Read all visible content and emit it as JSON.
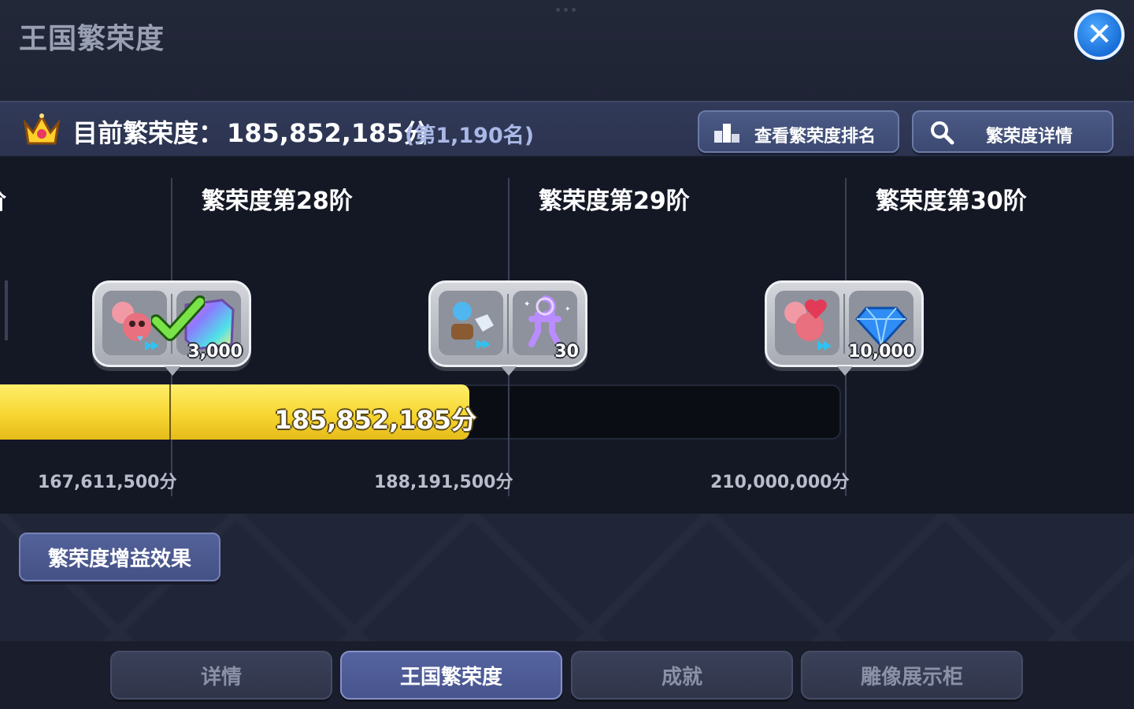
{
  "window": {
    "title": "王国繁荣度",
    "close_icon": "close-icon"
  },
  "status": {
    "label": "目前繁荣度：",
    "value": "185,852,185分",
    "rank": "(第1,190名)",
    "ranking_button": "查看繁荣度排名",
    "details_button": "繁荣度详情"
  },
  "progress": {
    "current": 185852185,
    "current_label": "185,852,185分",
    "track_max": 210000000,
    "partial_tier_title": "阶",
    "tiers": [
      {
        "title": "繁荣度第28阶",
        "threshold": 167611500,
        "threshold_label": "167,611,500分",
        "reward_quantity": "3,000",
        "claimed": true,
        "reward_icons": [
          "cookie-bundle-icon",
          "rainbow-cube-icon"
        ]
      },
      {
        "title": "繁荣度第29阶",
        "threshold": 188191500,
        "threshold_label": "188,191,500分",
        "reward_quantity": "30",
        "claimed": false,
        "reward_icons": [
          "materials-bundle-icon",
          "cookie-outline-icon"
        ]
      },
      {
        "title": "繁荣度第30阶",
        "threshold": 210000000,
        "threshold_label": "210,000,000分",
        "reward_quantity": "10,000",
        "claimed": false,
        "reward_icons": [
          "cookie-bundle-icon",
          "crystal-gem-icon"
        ]
      }
    ]
  },
  "buff_button": "繁荣度增益效果",
  "tabs": [
    {
      "label": "详情",
      "active": false
    },
    {
      "label": "王国繁荣度",
      "active": true
    },
    {
      "label": "成就",
      "active": false
    },
    {
      "label": "雕像展示柜",
      "active": false
    }
  ],
  "colors": {
    "accent_yellow": "#f7d632",
    "button_blue": "#445185",
    "close_blue": "#1a6fd8"
  }
}
